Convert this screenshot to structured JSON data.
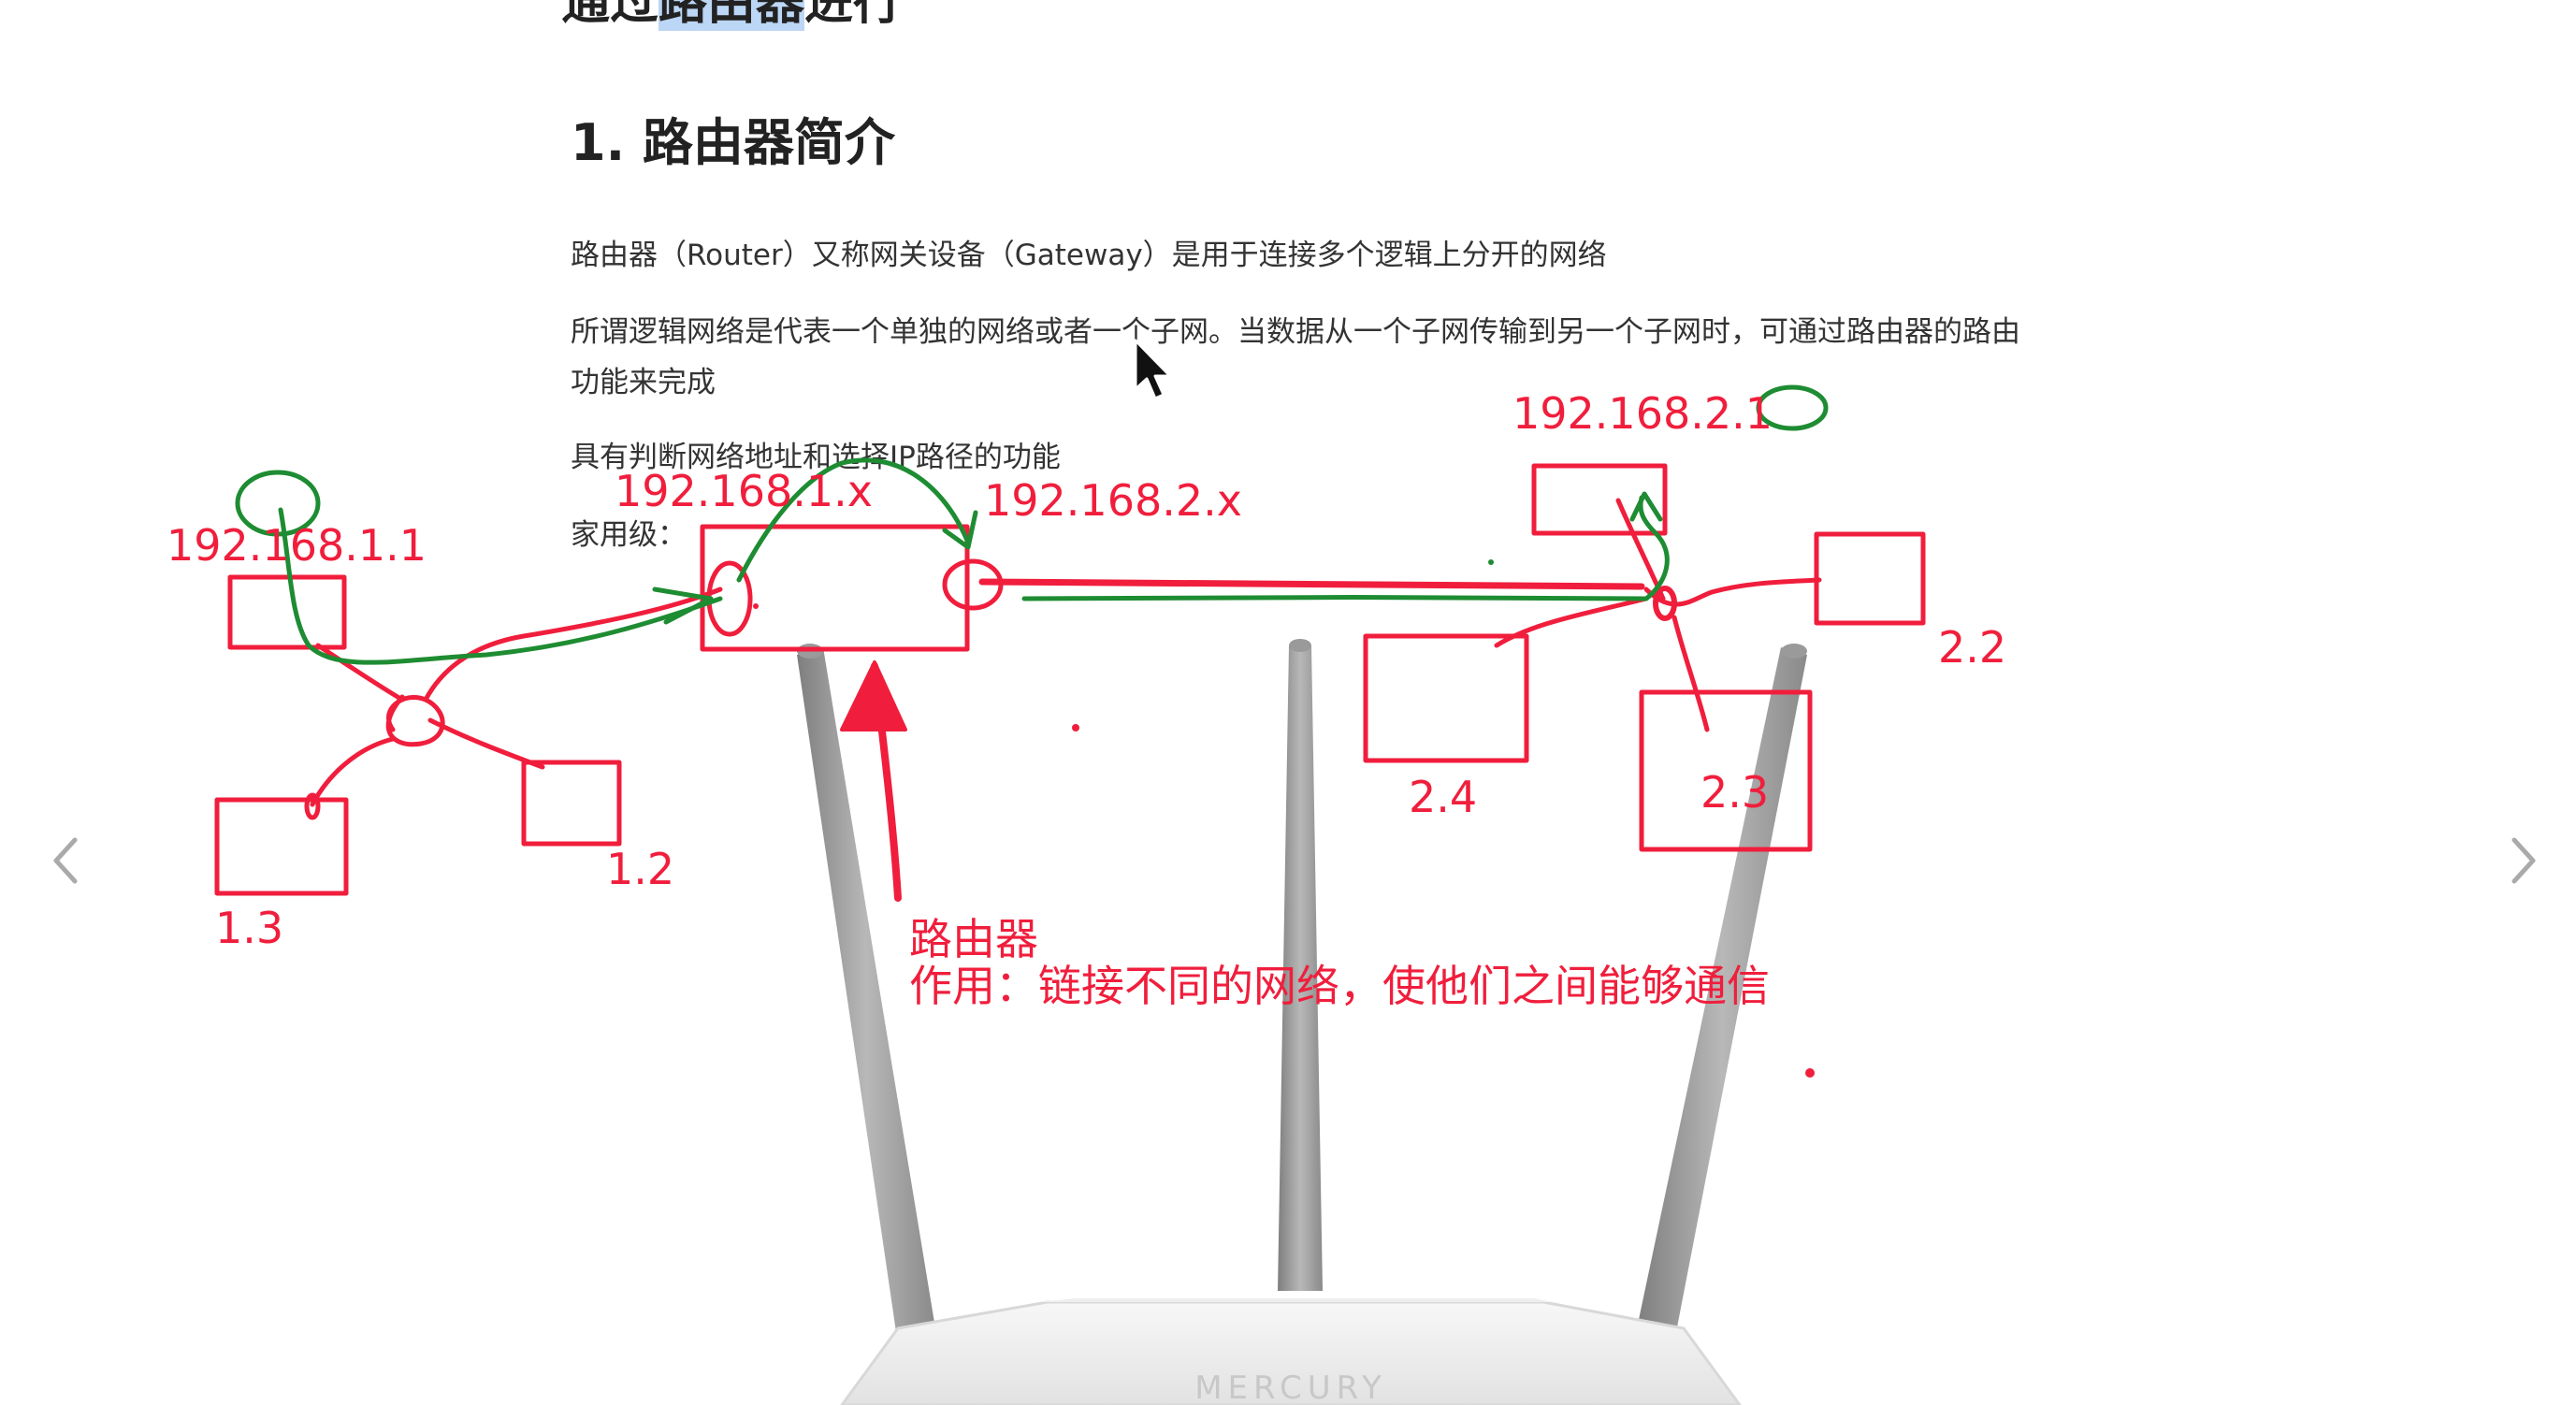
{
  "document": {
    "top_heading_partial": "通过路由器进行",
    "top_heading_highlight": "路由器",
    "section_title": "1. 路由器简介",
    "paragraphs": [
      "路由器（Router）又称网关设备（Gateway）是用于连接多个逻辑上分开的网络",
      "所谓逻辑网络是代表一个单独的网络或者一个子网。当数据从一个子网传输到另一个子网时，可通过路由器的路由功能来完成",
      "具有判断网络地址和选择IP路径的功能",
      "家用级："
    ]
  },
  "annotations": {
    "net1_gateway": "192.168.1.1",
    "net1_range": "192.168.1.x",
    "net2_range": "192.168.2.x",
    "net2_gateway": "192.168.2.1",
    "host_1_2": "1.2",
    "host_1_3": "1.3",
    "host_2_2": "2.2",
    "host_2_3": "2.3",
    "host_2_4": "2.4",
    "router_label": "路由器",
    "router_role": "作用：链接不同的网络，使他们之间能够通信"
  },
  "image": {
    "brand_text": "MERCURY"
  },
  "colors": {
    "annotation_red": "#f01e3c",
    "annotation_green": "#1e8c32",
    "heading_highlight": "#bcd6f5",
    "router_gray": "#9a9a9a"
  },
  "icons": {
    "prev": "chevron-left-icon",
    "next": "chevron-right-icon",
    "cursor": "mouse-pointer-icon"
  }
}
